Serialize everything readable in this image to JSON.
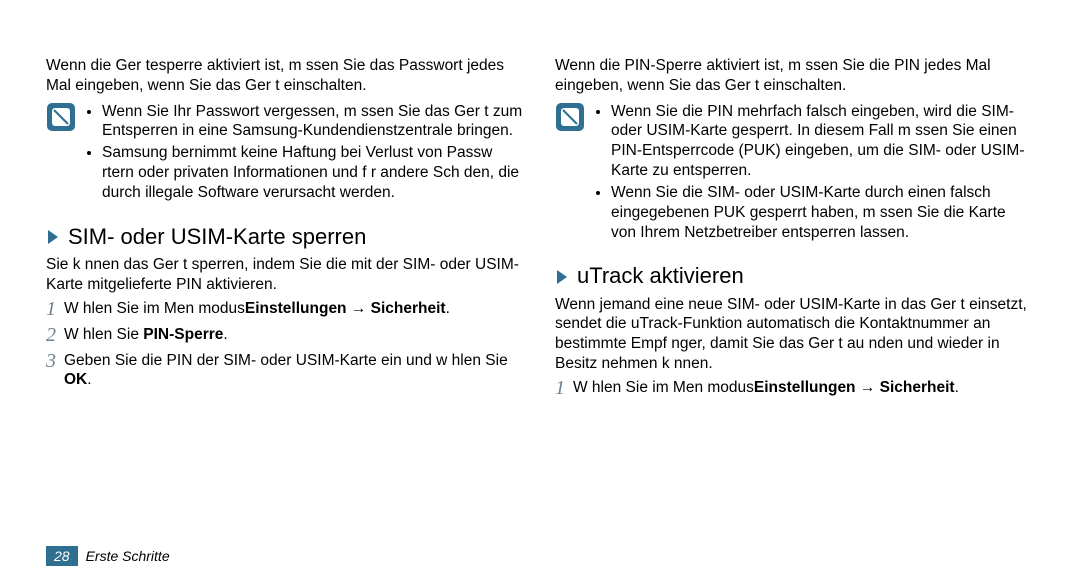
{
  "left": {
    "intro": "Wenn die Ger tesperre aktiviert ist, m ssen Sie das Passwort jedes Mal eingeben, wenn Sie das Ger t einschalten.",
    "notes": [
      "Wenn Sie Ihr Passwort vergessen, m ssen Sie das Ger t zum Entsperren in eine Samsung-Kundendienstzentrale bringen.",
      "Samsung  bernimmt keine Haftung bei Verlust von Passw rtern oder privaten Informationen und f r andere Sch den, die durch illegale Software verursacht werden."
    ],
    "heading": "SIM- oder USIM-Karte sperren",
    "heading_desc": "Sie k nnen das Ger t sperren, indem Sie die mit der SIM- oder USIM-Karte mitgelieferte PIN aktivieren.",
    "step1a": "W hlen Sie im Men modus",
    "step1b": "Einstellungen",
    "step1arrow": " → ",
    "step1c": "Sicherheit",
    "step2a": "W hlen Sie",
    "step2b": "PIN-Sperre",
    "step3a": "Geben Sie die PIN der SIM- oder USIM-Karte ein und w hlen Sie ",
    "step3b": "OK"
  },
  "right": {
    "intro": "Wenn die PIN-Sperre aktiviert ist, m ssen Sie die PIN jedes Mal eingeben, wenn Sie das Ger t einschalten.",
    "notes": [
      "Wenn Sie die PIN mehrfach falsch eingeben, wird die SIM- oder USIM-Karte gesperrt. In diesem Fall m ssen Sie einen PIN-Entsperrcode (PUK) eingeben, um die SIM- oder USIM-Karte zu entsperren.",
      "Wenn Sie die SIM- oder USIM-Karte durch einen falsch eingegebenen PUK gesperrt haben, m ssen Sie die Karte von Ihrem Netzbetreiber entsperren lassen."
    ],
    "heading": "uTrack aktivieren",
    "heading_desc": "Wenn jemand eine neue SIM- oder USIM-Karte in das Ger t einsetzt, sendet die uTrack-Funktion automatisch die Kontaktnummer an bestimmte Empf nger, damit Sie das Ger t au nden und wieder in Besitz nehmen k nnen.",
    "step1a": "W hlen Sie im Men modus",
    "step1b": "Einstellungen",
    "step1arrow": " → ",
    "step1c": "Sicherheit"
  },
  "footer": {
    "page": "28",
    "section": "Erste Schritte"
  }
}
